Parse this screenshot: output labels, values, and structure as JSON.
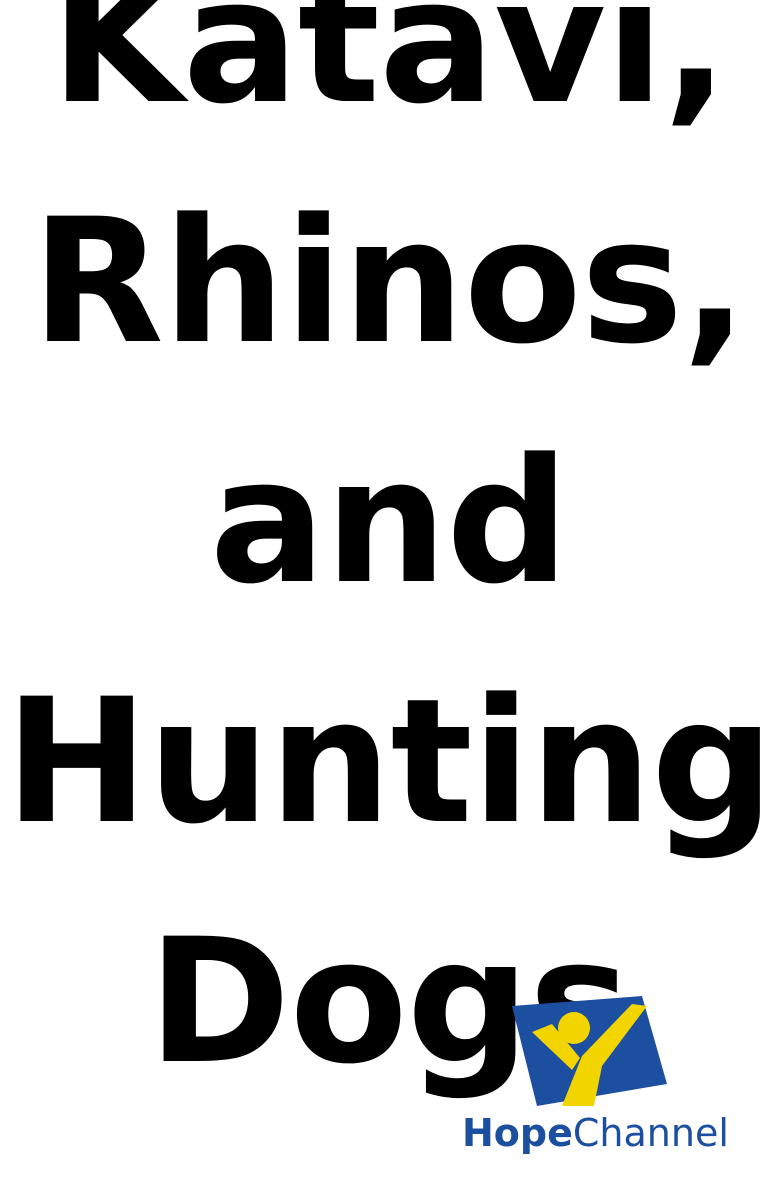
{
  "title": {
    "lines": [
      "Katavi,",
      "Rhinos,",
      "and",
      "Hunting",
      "Dogs"
    ]
  },
  "logo": {
    "name": "hope-channel-logo",
    "wordmark_hope": "Hope",
    "wordmark_channel": "Channel",
    "colors": {
      "blue": "#1c4fa0",
      "yellow": "#f2d500"
    }
  }
}
